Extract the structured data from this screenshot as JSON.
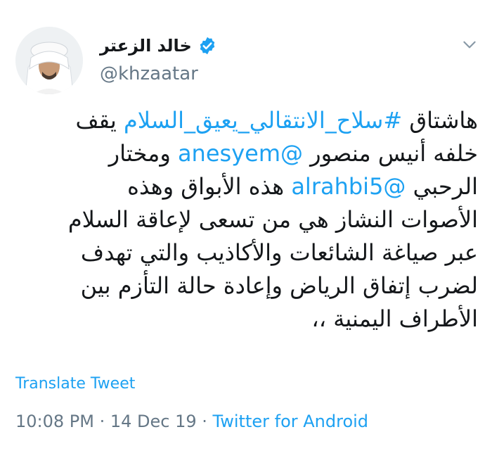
{
  "author": {
    "display_name": "خالد الزعتر",
    "handle": "@khzaatar",
    "verified": true
  },
  "tweet": {
    "lines": [
      [
        {
          "text": "هاشتاق ",
          "link": false
        },
        {
          "text": "#سلاح_الانتقالي_يعيق_السلام",
          "link": true
        },
        {
          "text": " يقف",
          "link": false
        }
      ],
      [
        {
          "text": "خلفه أنيس منصور ",
          "link": false
        },
        {
          "text": "@anesyem",
          "link": true
        },
        {
          "text": " ومختار",
          "link": false
        }
      ],
      [
        {
          "text": "الرحبي ",
          "link": false
        },
        {
          "text": "@alrahbi5",
          "link": true
        },
        {
          "text": "  هذه الأبواق وهذه",
          "link": false
        }
      ],
      [
        {
          "text": "الأصوات النشاز هي من تسعى لإعاقة السلام",
          "link": false
        }
      ],
      [
        {
          "text": "عبر صياغة الشائعات والأكاذيب والتي تهدف",
          "link": false
        }
      ],
      [
        {
          "text": "لضرب إتفاق الرياض وإعادة حالة التأزم بين",
          "link": false
        }
      ],
      [
        {
          "text": "الأطراف اليمنية ،،",
          "link": false
        }
      ]
    ]
  },
  "translate_label": "Translate Tweet",
  "meta": {
    "time": "10:08 PM",
    "separator": " · ",
    "date": "14 Dec 19",
    "source": "Twitter for Android"
  },
  "icons": {
    "verified": "verified-badge-icon",
    "caret": "chevron-down-icon"
  },
  "colors": {
    "link": "#1da1f2",
    "text": "#14171a",
    "muted": "#657786",
    "verified": "#1da1f2"
  }
}
